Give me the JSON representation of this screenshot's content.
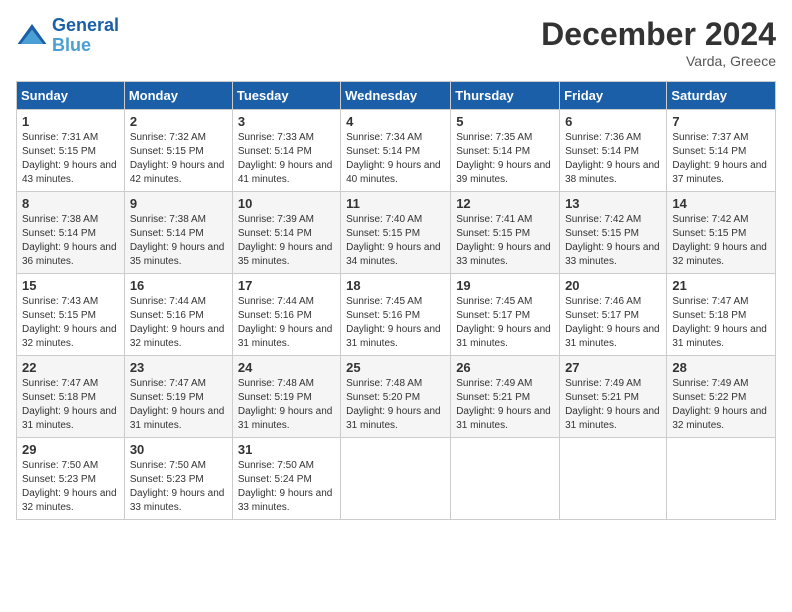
{
  "header": {
    "logo_line1": "General",
    "logo_line2": "Blue",
    "month_title": "December 2024",
    "location": "Varda, Greece"
  },
  "days_of_week": [
    "Sunday",
    "Monday",
    "Tuesday",
    "Wednesday",
    "Thursday",
    "Friday",
    "Saturday"
  ],
  "weeks": [
    [
      {
        "day": 1,
        "sunrise": "7:31 AM",
        "sunset": "5:15 PM",
        "daylight": "9 hours and 43 minutes."
      },
      {
        "day": 2,
        "sunrise": "7:32 AM",
        "sunset": "5:15 PM",
        "daylight": "9 hours and 42 minutes."
      },
      {
        "day": 3,
        "sunrise": "7:33 AM",
        "sunset": "5:14 PM",
        "daylight": "9 hours and 41 minutes."
      },
      {
        "day": 4,
        "sunrise": "7:34 AM",
        "sunset": "5:14 PM",
        "daylight": "9 hours and 40 minutes."
      },
      {
        "day": 5,
        "sunrise": "7:35 AM",
        "sunset": "5:14 PM",
        "daylight": "9 hours and 39 minutes."
      },
      {
        "day": 6,
        "sunrise": "7:36 AM",
        "sunset": "5:14 PM",
        "daylight": "9 hours and 38 minutes."
      },
      {
        "day": 7,
        "sunrise": "7:37 AM",
        "sunset": "5:14 PM",
        "daylight": "9 hours and 37 minutes."
      }
    ],
    [
      {
        "day": 8,
        "sunrise": "7:38 AM",
        "sunset": "5:14 PM",
        "daylight": "9 hours and 36 minutes."
      },
      {
        "day": 9,
        "sunrise": "7:38 AM",
        "sunset": "5:14 PM",
        "daylight": "9 hours and 35 minutes."
      },
      {
        "day": 10,
        "sunrise": "7:39 AM",
        "sunset": "5:14 PM",
        "daylight": "9 hours and 35 minutes."
      },
      {
        "day": 11,
        "sunrise": "7:40 AM",
        "sunset": "5:15 PM",
        "daylight": "9 hours and 34 minutes."
      },
      {
        "day": 12,
        "sunrise": "7:41 AM",
        "sunset": "5:15 PM",
        "daylight": "9 hours and 33 minutes."
      },
      {
        "day": 13,
        "sunrise": "7:42 AM",
        "sunset": "5:15 PM",
        "daylight": "9 hours and 33 minutes."
      },
      {
        "day": 14,
        "sunrise": "7:42 AM",
        "sunset": "5:15 PM",
        "daylight": "9 hours and 32 minutes."
      }
    ],
    [
      {
        "day": 15,
        "sunrise": "7:43 AM",
        "sunset": "5:15 PM",
        "daylight": "9 hours and 32 minutes."
      },
      {
        "day": 16,
        "sunrise": "7:44 AM",
        "sunset": "5:16 PM",
        "daylight": "9 hours and 32 minutes."
      },
      {
        "day": 17,
        "sunrise": "7:44 AM",
        "sunset": "5:16 PM",
        "daylight": "9 hours and 31 minutes."
      },
      {
        "day": 18,
        "sunrise": "7:45 AM",
        "sunset": "5:16 PM",
        "daylight": "9 hours and 31 minutes."
      },
      {
        "day": 19,
        "sunrise": "7:45 AM",
        "sunset": "5:17 PM",
        "daylight": "9 hours and 31 minutes."
      },
      {
        "day": 20,
        "sunrise": "7:46 AM",
        "sunset": "5:17 PM",
        "daylight": "9 hours and 31 minutes."
      },
      {
        "day": 21,
        "sunrise": "7:47 AM",
        "sunset": "5:18 PM",
        "daylight": "9 hours and 31 minutes."
      }
    ],
    [
      {
        "day": 22,
        "sunrise": "7:47 AM",
        "sunset": "5:18 PM",
        "daylight": "9 hours and 31 minutes."
      },
      {
        "day": 23,
        "sunrise": "7:47 AM",
        "sunset": "5:19 PM",
        "daylight": "9 hours and 31 minutes."
      },
      {
        "day": 24,
        "sunrise": "7:48 AM",
        "sunset": "5:19 PM",
        "daylight": "9 hours and 31 minutes."
      },
      {
        "day": 25,
        "sunrise": "7:48 AM",
        "sunset": "5:20 PM",
        "daylight": "9 hours and 31 minutes."
      },
      {
        "day": 26,
        "sunrise": "7:49 AM",
        "sunset": "5:21 PM",
        "daylight": "9 hours and 31 minutes."
      },
      {
        "day": 27,
        "sunrise": "7:49 AM",
        "sunset": "5:21 PM",
        "daylight": "9 hours and 31 minutes."
      },
      {
        "day": 28,
        "sunrise": "7:49 AM",
        "sunset": "5:22 PM",
        "daylight": "9 hours and 32 minutes."
      }
    ],
    [
      {
        "day": 29,
        "sunrise": "7:50 AM",
        "sunset": "5:23 PM",
        "daylight": "9 hours and 32 minutes."
      },
      {
        "day": 30,
        "sunrise": "7:50 AM",
        "sunset": "5:23 PM",
        "daylight": "9 hours and 33 minutes."
      },
      {
        "day": 31,
        "sunrise": "7:50 AM",
        "sunset": "5:24 PM",
        "daylight": "9 hours and 33 minutes."
      },
      null,
      null,
      null,
      null
    ]
  ]
}
